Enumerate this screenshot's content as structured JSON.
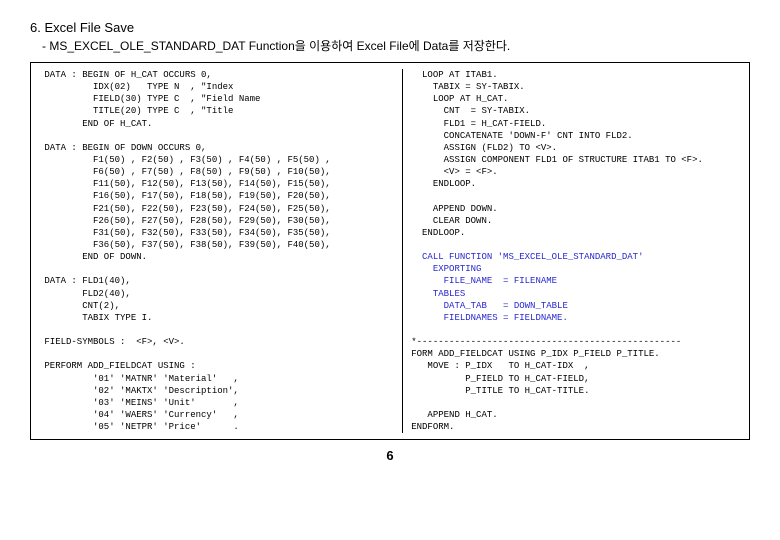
{
  "heading": "6. Excel File Save",
  "subheading": "- MS_EXCEL_OLE_STANDARD_DAT Function을 이용하여 Excel File에 Data를 저장한다.",
  "left": {
    "l01": " DATA : BEGIN OF H_CAT OCCURS 0,",
    "l02": "          IDX(02)   TYPE N  , \"Index",
    "l03": "          FIELD(30) TYPE C  , \"Field Name",
    "l04": "          TITLE(20) TYPE C  , \"Title",
    "l05": "        END OF H_CAT.",
    "l06": "",
    "l07": " DATA : BEGIN OF DOWN OCCURS 0,",
    "l08": "          F1(50) , F2(50) , F3(50) , F4(50) , F5(50) ,",
    "l09": "          F6(50) , F7(50) , F8(50) , F9(50) , F10(50),",
    "l10": "          F11(50), F12(50), F13(50), F14(50), F15(50),",
    "l11": "          F16(50), F17(50), F18(50), F19(50), F20(50),",
    "l12": "          F21(50), F22(50), F23(50), F24(50), F25(50),",
    "l13": "          F26(50), F27(50), F28(50), F29(50), F30(50),",
    "l14": "          F31(50), F32(50), F33(50), F34(50), F35(50),",
    "l15": "          F36(50), F37(50), F38(50), F39(50), F40(50),",
    "l16": "        END OF DOWN.",
    "l17": "",
    "l18": " DATA : FLD1(40),",
    "l19": "        FLD2(40),",
    "l20": "        CNT(2),",
    "l21": "        TABIX TYPE I.",
    "l22": "",
    "l23": " FIELD-SYMBOLS :  <F>, <V>.",
    "l24": "",
    "l25": " PERFORM ADD_FIELDCAT USING :",
    "l26": "          '01' 'MATNR' 'Material'   ,",
    "l27": "          '02' 'MAKTX' 'Description',",
    "l28": "          '03' 'MEINS' 'Unit'       ,",
    "l29": "          '04' 'WAERS' 'Currency'   ,",
    "l30": "          '05' 'NETPR' 'Price'      ."
  },
  "right": {
    "r01": "  LOOP AT ITAB1.",
    "r02": "    TABIX = SY-TABIX.",
    "r03": "    LOOP AT H_CAT.",
    "r04": "      CNT  = SY-TABIX.",
    "r05": "      FLD1 = H_CAT-FIELD.",
    "r06": "      CONCATENATE 'DOWN-F' CNT INTO FLD2.",
    "r07": "      ASSIGN (FLD2) TO <V>.",
    "r08": "      ASSIGN COMPONENT FLD1 OF STRUCTURE ITAB1 TO <F>.",
    "r09": "      <V> = <F>.",
    "r10": "    ENDLOOP.",
    "r11": "",
    "r12": "    APPEND DOWN.",
    "r13": "    CLEAR DOWN.",
    "r14": "  ENDLOOP.",
    "r15": "",
    "r16a": "  CALL FUNCTION ",
    "r16b": "'MS_EXCEL_OLE_STANDARD_DAT'",
    "r17": "    EXPORTING",
    "r18": "      FILE_NAME  = FILENAME",
    "r19": "    TABLES",
    "r20": "      DATA_TAB   = DOWN_TABLE",
    "r21": "      FIELDNAMES = FIELDNAME.",
    "r22": "",
    "r23": "*-------------------------------------------------",
    "r24": "FORM ADD_FIELDCAT USING P_IDX P_FIELD P_TITLE.",
    "r25": "   MOVE : P_IDX   TO H_CAT-IDX  ,",
    "r26": "          P_FIELD TO H_CAT-FIELD,",
    "r27": "          P_TITLE TO H_CAT-TITLE.",
    "r28": "",
    "r29": "   APPEND H_CAT.",
    "r30": "ENDFORM."
  },
  "pagenum": "6"
}
